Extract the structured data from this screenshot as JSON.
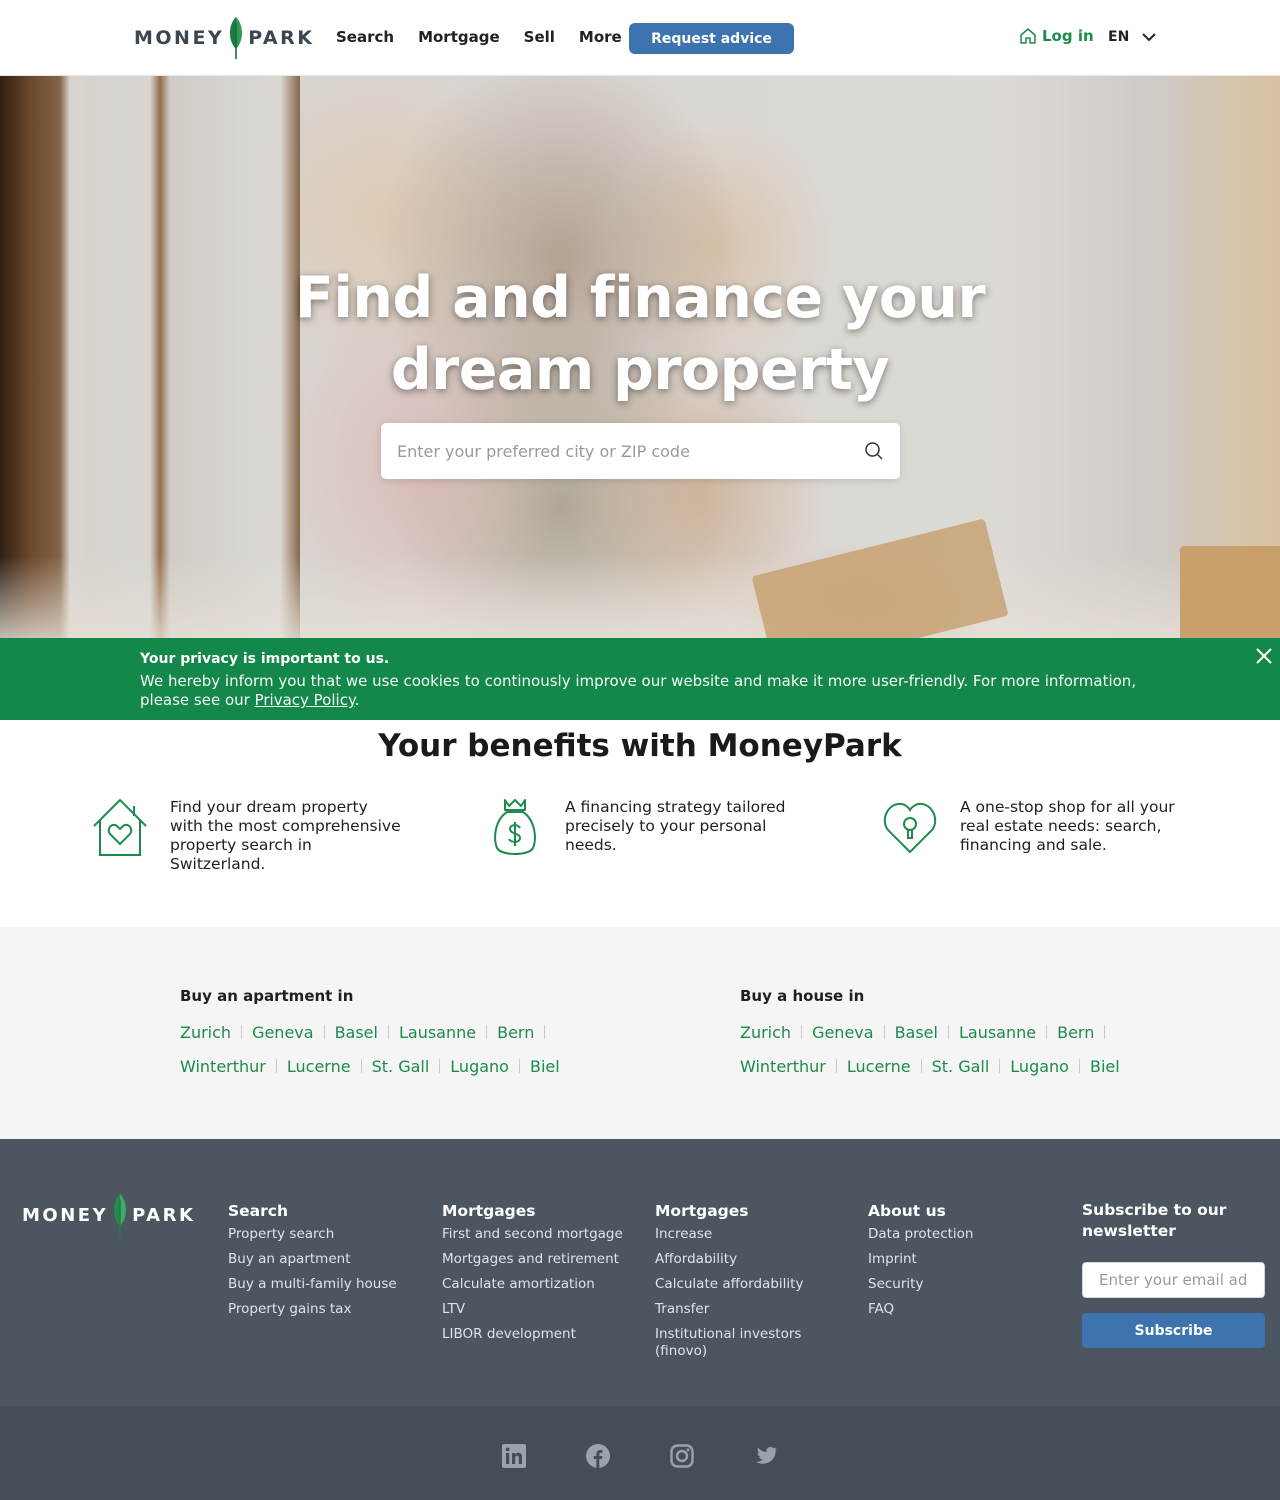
{
  "brand": {
    "left": "MONEY",
    "right": "PARK",
    "leaf_color": "#1e8a4c"
  },
  "nav": {
    "items": [
      "Search",
      "Mortgage",
      "Sell",
      "More"
    ],
    "cta": "Request advice",
    "login": "Log in",
    "language": "EN"
  },
  "hero": {
    "title_line1": "Find and finance your",
    "title_line2": "dream property",
    "search_placeholder": "Enter your preferred city or ZIP code"
  },
  "cookie": {
    "title": "Your privacy is important to us.",
    "text": "We hereby inform you that we use cookies to continously improve our website and make it more user-friendly. For more information, please see our ",
    "link": "Privacy Policy",
    "after_link": "."
  },
  "benefits": {
    "title": "Your benefits with MoneyPark",
    "items": [
      {
        "icon": "house-heart-icon",
        "text": "Find your dream property with the most comprehensive property search in Switzerland."
      },
      {
        "icon": "money-bag-icon",
        "text": "A financing strategy tailored precisely to your personal needs."
      },
      {
        "icon": "heart-keyhole-icon",
        "text": "A one-stop shop for all your real estate needs: search, financing and sale."
      }
    ]
  },
  "buy": {
    "apartment_title": "Buy an apartment in",
    "house_title": "Buy a house in",
    "row1": [
      "Zurich",
      "Geneva",
      "Basel",
      "Lausanne",
      "Bern"
    ],
    "row2": [
      "Winterthur",
      "Lucerne",
      "St. Gall",
      "Lugano",
      "Biel"
    ]
  },
  "footer": {
    "columns": [
      {
        "title": "Search",
        "links": [
          "Property search",
          "Buy an apartment",
          "Buy a multi-family house",
          "Property gains tax"
        ]
      },
      {
        "title": "Mortgages",
        "links": [
          "First and second mortgage",
          "Mortgages and retirement",
          "Calculate amortization",
          "LTV",
          "LIBOR development"
        ]
      },
      {
        "title": "Mortgages",
        "links": [
          "Increase",
          "Affordability",
          "Calculate affordability",
          "Transfer",
          "Institutional investors (finovo)"
        ]
      },
      {
        "title": "About us",
        "links": [
          "Data protection",
          "Imprint",
          "Security",
          "FAQ"
        ]
      }
    ],
    "newsletter": {
      "title": "Subscribe to our newsletter",
      "placeholder": "Enter your email address",
      "button": "Subscribe"
    },
    "social": [
      "linkedin-icon",
      "facebook-icon",
      "instagram-icon",
      "twitter-icon"
    ]
  },
  "colors": {
    "green": "#1e8a4c",
    "cookie_green": "#14874a",
    "blue": "#3d74b0",
    "footer": "#4b5661"
  }
}
